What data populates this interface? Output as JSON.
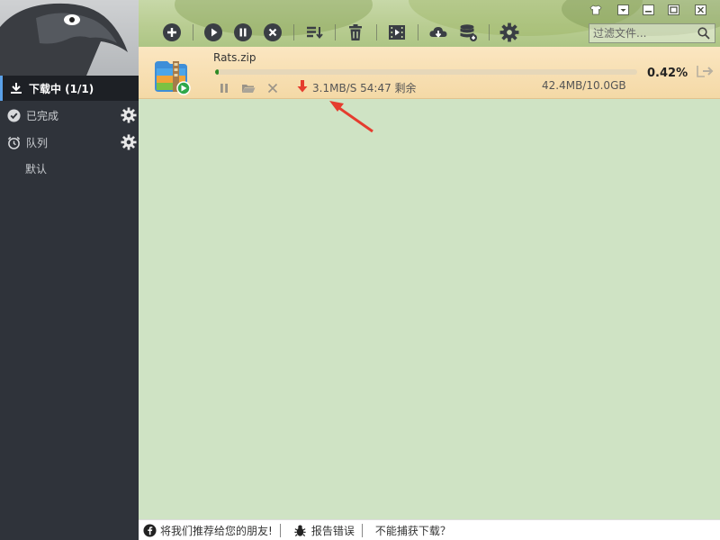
{
  "sidebar": {
    "items": [
      {
        "label": "下载中 (1/1)"
      },
      {
        "label": "已完成"
      },
      {
        "label": "队列"
      }
    ],
    "sub_label": "默认"
  },
  "search": {
    "placeholder": "过滤文件..."
  },
  "toolbar": {
    "icons": [
      "add-icon",
      "play-icon",
      "pause-icon",
      "stop-icon",
      "sort-icon",
      "trash-icon",
      "video-icon",
      "cloud-download-icon",
      "database-icon",
      "settings-icon"
    ]
  },
  "download": {
    "filename": "Rats.zip",
    "progress_percent": 0.42,
    "progress_label": "0.42%",
    "size": "42.4MB/10.0GB",
    "speed": "3.1MB/S 54:47 剩余"
  },
  "footer": {
    "share": "将我们推荐给您的朋友!",
    "report": "报告错误",
    "capture": "不能捕获下载？"
  },
  "colors": {
    "sidebar_bg": "#2f333a",
    "content_bg": "#cfe3c4",
    "row_bg": "#f6dcaa",
    "progress": "#2f8a24",
    "accent_red": "#e53c2e"
  }
}
